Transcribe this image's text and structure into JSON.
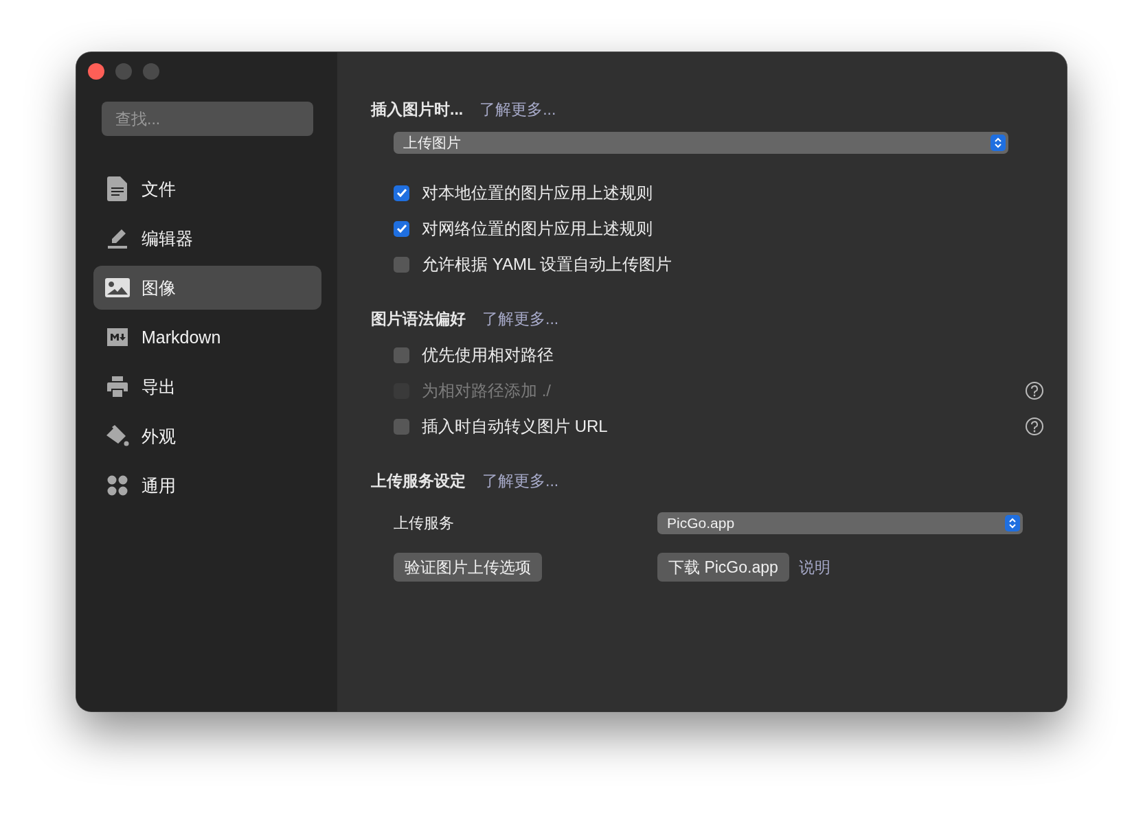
{
  "window": {
    "controls": [
      {
        "kind": "close"
      },
      {
        "kind": "minimize"
      },
      {
        "kind": "zoom"
      }
    ]
  },
  "sidebar": {
    "search": {
      "placeholder": "查找..."
    },
    "items": [
      {
        "label": "文件",
        "selected": false
      },
      {
        "label": "编辑器",
        "selected": false
      },
      {
        "label": "图像",
        "selected": true
      },
      {
        "label": "Markdown",
        "selected": false
      },
      {
        "label": "导出",
        "selected": false
      },
      {
        "label": "外观",
        "selected": false
      },
      {
        "label": "通用",
        "selected": false
      }
    ]
  },
  "sections": [
    {
      "title": "插入图片时...",
      "link": "了解更多...",
      "items": [
        {
          "kind": "dropdown",
          "value": "上传图片"
        },
        {
          "kind": "checkbox",
          "label": "对本地位置的图片应用上述规则",
          "checked": true,
          "disabled": false,
          "help": false
        },
        {
          "kind": "checkbox",
          "label": "对网络位置的图片应用上述规则",
          "checked": true,
          "disabled": false,
          "help": false
        },
        {
          "kind": "checkbox",
          "label": "允许根据 YAML 设置自动上传图片",
          "checked": false,
          "disabled": false,
          "help": false
        }
      ]
    },
    {
      "title": "图片语法偏好",
      "link": "了解更多...",
      "items": [
        {
          "kind": "checkbox",
          "label": "优先使用相对路径",
          "checked": false,
          "disabled": false,
          "help": false
        },
        {
          "kind": "checkbox",
          "label": "为相对路径添加 ./",
          "checked": false,
          "disabled": true,
          "help": true
        },
        {
          "kind": "checkbox",
          "label": "插入时自动转义图片 URL",
          "checked": false,
          "disabled": false,
          "help": true
        }
      ]
    },
    {
      "title": "上传服务设定",
      "link": "了解更多...",
      "items": [
        {
          "kind": "select-row",
          "label": "上传服务",
          "value": "PicGo.app"
        },
        {
          "kind": "button-row",
          "button": "验证图片上传选项",
          "button_2": "下载 PicGo.app",
          "link": "说明"
        }
      ]
    }
  ]
}
